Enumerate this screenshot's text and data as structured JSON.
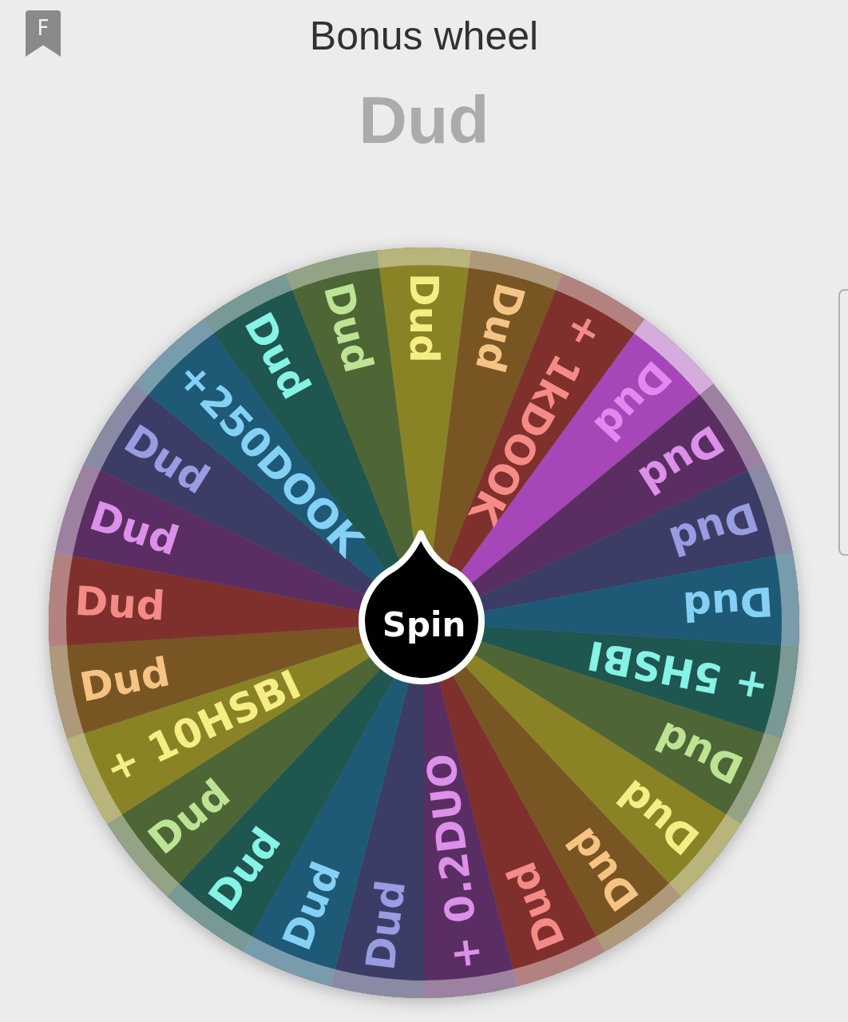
{
  "header": {
    "badge": "F",
    "title": "Bonus wheel"
  },
  "result": "Dud",
  "spin_label": "Spin",
  "segments": [
    {
      "label": "Dud",
      "color": "#8a8326",
      "selected": false
    },
    {
      "label": "Dud",
      "color": "#7a5524",
      "selected": false
    },
    {
      "label": "+ 1kDOOK",
      "color": "#80302c",
      "selected": false
    },
    {
      "label": "Dud",
      "color": "#a646b8",
      "selected": true
    },
    {
      "label": "Dud",
      "color": "#5a2e62",
      "selected": false
    },
    {
      "label": "Dud",
      "color": "#3b3d66",
      "selected": false
    },
    {
      "label": "Dud",
      "color": "#1e5a76",
      "selected": false
    },
    {
      "label": "+ 5HSBI",
      "color": "#1f5650",
      "selected": false
    },
    {
      "label": "Dud",
      "color": "#4e6636",
      "selected": false
    },
    {
      "label": "Dud",
      "color": "#8a8326",
      "selected": false
    },
    {
      "label": "Dud",
      "color": "#7a5524",
      "selected": false
    },
    {
      "label": "Dud",
      "color": "#80302c",
      "selected": false
    },
    {
      "label": "+ 0.2DUO",
      "color": "#5a2e62",
      "selected": false
    },
    {
      "label": "Dud",
      "color": "#3b3d66",
      "selected": false
    },
    {
      "label": "Dud",
      "color": "#1e5a76",
      "selected": false
    },
    {
      "label": "Dud",
      "color": "#1f5650",
      "selected": false
    },
    {
      "label": "Dud",
      "color": "#4e6636",
      "selected": false
    },
    {
      "label": "+ 10HSBI",
      "color": "#8a8326",
      "selected": false
    },
    {
      "label": "Dud",
      "color": "#7a5524",
      "selected": false
    },
    {
      "label": "Dud",
      "color": "#80302c",
      "selected": false
    },
    {
      "label": "Dud",
      "color": "#5a2e62",
      "selected": false
    },
    {
      "label": "Dud",
      "color": "#3b3d66",
      "selected": false
    },
    {
      "label": "+250DOOK",
      "color": "#1e5a76",
      "selected": false
    },
    {
      "label": "Dud",
      "color": "#1f5650",
      "selected": false
    },
    {
      "label": "Dud",
      "color": "#4e6636",
      "selected": false
    }
  ]
}
